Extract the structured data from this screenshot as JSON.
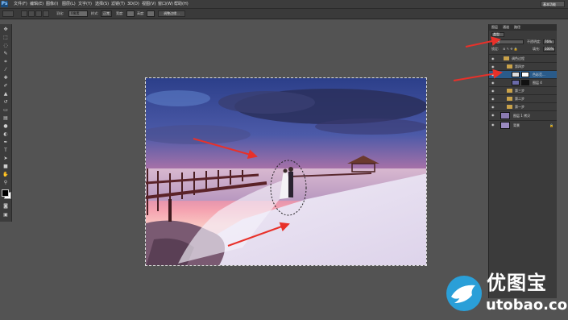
{
  "app": {
    "logo": "Ps"
  },
  "menu": [
    "文件(F)",
    "编辑(E)",
    "图像(I)",
    "图层(L)",
    "文字(Y)",
    "选择(S)",
    "滤镜(T)",
    "3D(D)",
    "视图(V)",
    "窗口(W)",
    "帮助(H)"
  ],
  "workspace": "基本功能",
  "options_bar": {
    "feather_label": "羽化:",
    "feather_value": "0像素",
    "style_label": "样式:",
    "style_value": "正常",
    "width_label": "宽度:",
    "height_label": "高度:",
    "refine_edge": "调整边缘..."
  },
  "layers_panel": {
    "tabs": [
      "图层",
      "通道",
      "路径"
    ],
    "filter": "类型",
    "blend_mode": "滤色",
    "opacity_label": "不透明度:",
    "opacity_value": "76%",
    "lock_label": "锁定:",
    "fill_label": "填充:",
    "fill_value": "100%",
    "layers": [
      {
        "name": "调色过程",
        "type": "group",
        "indent": 0,
        "selected": false
      },
      {
        "name": "第四步",
        "type": "group",
        "indent": 1,
        "selected": false
      },
      {
        "name": "色彩范...",
        "type": "adjustment",
        "indent": 2,
        "selected": true
      },
      {
        "name": "图层 4",
        "type": "pixel",
        "indent": 2,
        "selected": false
      },
      {
        "name": "第三步",
        "type": "group",
        "indent": 1,
        "selected": false
      },
      {
        "name": "第二步",
        "type": "group",
        "indent": 1,
        "selected": false
      },
      {
        "name": "第一步",
        "type": "group",
        "indent": 1,
        "selected": false
      },
      {
        "name": "图层 1 拷贝",
        "type": "pixel",
        "indent": 0,
        "selected": false
      },
      {
        "name": "背景",
        "type": "pixel",
        "indent": 0,
        "selected": false,
        "locked": true
      }
    ]
  },
  "tools": [
    "move-icon",
    "marquee-icon",
    "lasso-icon",
    "quick-select-icon",
    "crop-icon",
    "eyedropper-icon",
    "healing-icon",
    "brush-icon",
    "stamp-icon",
    "history-brush-icon",
    "eraser-icon",
    "gradient-icon",
    "blur-icon",
    "dodge-icon",
    "pen-icon",
    "type-icon",
    "path-select-icon",
    "shape-icon",
    "hand-icon",
    "zoom-icon"
  ],
  "watermark": {
    "brand": "优图宝",
    "url": "utobao.com"
  },
  "colors": {
    "arrow": "#e8312a",
    "selected_layer": "#2a5b8a",
    "background": "#535353"
  }
}
